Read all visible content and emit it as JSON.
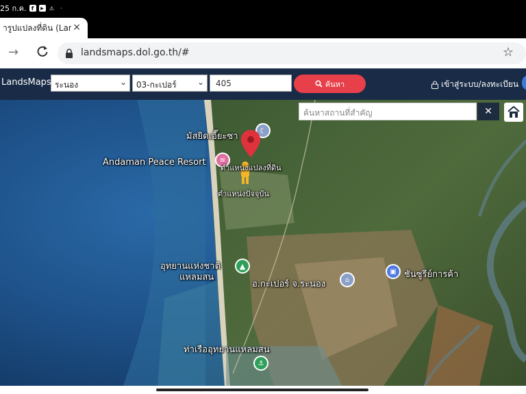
{
  "status_bar": {
    "time": "25 ก.ค.",
    "icons": [
      "facebook-icon",
      "youtube-icon",
      "warning-icon",
      "dot-icon"
    ]
  },
  "browser": {
    "tab_title": "ารูปแปลงที่ดิน (Land",
    "tab_close": "×",
    "new_tab": "+",
    "url": "landsmaps.dol.go.th/#"
  },
  "app": {
    "brand": "LandsMaps",
    "province": "ระนอง",
    "district": "03-กะเปอร์",
    "parcel_number": "405",
    "search_label": "ค้นหา",
    "login_label": "เข้าสู่ระบบ/ลงทะเบียน"
  },
  "map": {
    "place_search_placeholder": "ค้นหาสถานที่สำคัญ",
    "labels": {
      "mosque": "มัสยิดเอี๊ยะซา",
      "resort": "Andaman Peace Resort",
      "parcel_location": "ตำแหน่งแปลงที่ดิน",
      "street_view": "ตำแหน่งปัจจุบัน",
      "national_park": "อุทยานแห่งชาติ",
      "national_park_2": "แหลมสน",
      "district_office": "อ.กะเปอร์ จ.ระนอง",
      "viewpoint": "ชันซูรีย์การค้า",
      "pier": "ท่าเรืออุทยานแหลมสน"
    }
  },
  "colors": {
    "header": "#192b46",
    "search_button": "#e8404a",
    "marker": "#e0323c"
  }
}
